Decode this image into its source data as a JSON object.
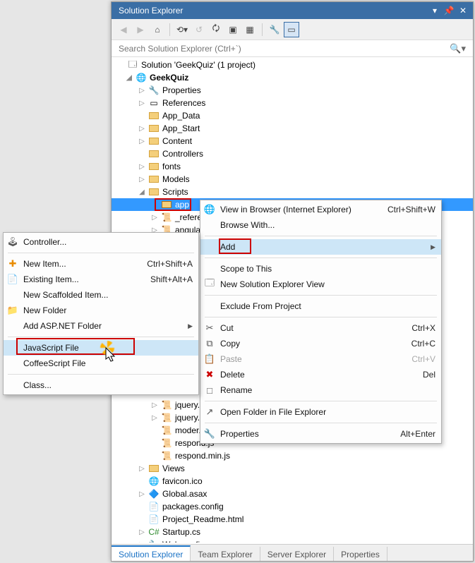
{
  "panel": {
    "title": "Solution Explorer"
  },
  "search": {
    "placeholder": "Search Solution Explorer (Ctrl+`)"
  },
  "tree": {
    "solution": "Solution 'GeekQuiz' (1 project)",
    "project": "GeekQuiz",
    "items": [
      "Properties",
      "References",
      "App_Data",
      "App_Start",
      "Content",
      "Controllers",
      "fonts",
      "Models",
      "Scripts"
    ],
    "scripts_app": "app",
    "scripts_children_top": [
      "_refere",
      "angula"
    ],
    "scripts_children_bottom": [
      "jquery...",
      "jquery...",
      "moder......",
      "respond.js",
      "respond.min.js"
    ],
    "after_scripts": [
      "Views",
      "favicon.ico",
      "Global.asax",
      "packages.config",
      "Project_Readme.html",
      "Startup.cs",
      "Web.config"
    ]
  },
  "tabs": {
    "t1": "Solution Explorer",
    "t2": "Team Explorer",
    "t3": "Server Explorer",
    "t4": "Properties"
  },
  "ctx_right": {
    "r1": "View in Browser (Internet Explorer)",
    "r1_sc": "Ctrl+Shift+W",
    "r2": "Browse With...",
    "r3": "Add",
    "r4": "Scope to This",
    "r5": "New Solution Explorer View",
    "r6": "Exclude From Project",
    "r7": "Cut",
    "r7_sc": "Ctrl+X",
    "r8": "Copy",
    "r8_sc": "Ctrl+C",
    "r9": "Paste",
    "r9_sc": "Ctrl+V",
    "r10": "Delete",
    "r10_sc": "Del",
    "r11": "Rename",
    "r12": "Open Folder in File Explorer",
    "r13": "Properties",
    "r13_sc": "Alt+Enter"
  },
  "ctx_left": {
    "l1": "Controller...",
    "l2": "New Item...",
    "l2_sc": "Ctrl+Shift+A",
    "l3": "Existing Item...",
    "l3_sc": "Shift+Alt+A",
    "l4": "New Scaffolded Item...",
    "l5": "New Folder",
    "l6": "Add ASP.NET Folder",
    "l7": "JavaScript File",
    "l8": "CoffeeScript File",
    "l9": "Class..."
  }
}
